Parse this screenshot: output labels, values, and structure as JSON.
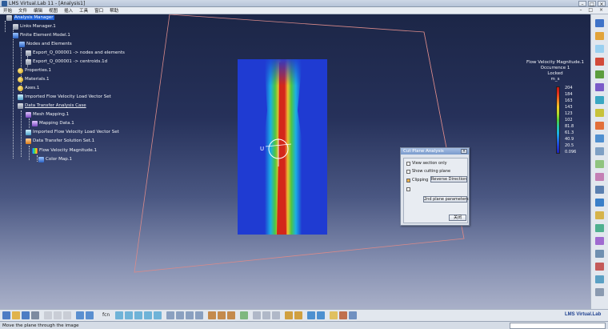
{
  "window": {
    "title": "LMS Virtual.Lab 11 - [Analysis1]",
    "minimize": "–",
    "maximize": "□",
    "close": "×"
  },
  "menu": {
    "items": [
      "开始",
      "文件",
      "编辑",
      "视图",
      "插入",
      "工具",
      "窗口",
      "帮助"
    ],
    "doc_controls": "– □ ×"
  },
  "tree": {
    "nodes": [
      {
        "label": "Analysis Manager",
        "icon": "analysis-manager-icon",
        "color": "gray",
        "selected": true
      },
      {
        "label": "Links Manager.1",
        "icon": "links-manager-icon",
        "color": "gray"
      },
      {
        "label": "Finite Element Model.1",
        "icon": "fe-model-icon",
        "color": "blue"
      },
      {
        "label": "Nodes and Elements",
        "icon": "nodes-elements-icon",
        "color": "blue"
      },
      {
        "label": "Export_Q_000001 -> nodes and elements",
        "icon": "export-icon",
        "color": "gray"
      },
      {
        "label": "Export_Q_000001 -> centroids.1d",
        "icon": "export-icon",
        "color": "gray"
      },
      {
        "label": "Properties.1",
        "icon": "properties-icon",
        "color": "yellow"
      },
      {
        "label": "Materials.1",
        "icon": "materials-icon",
        "color": "yellow"
      },
      {
        "label": "Axes.1",
        "icon": "axes-icon",
        "color": "yellow"
      },
      {
        "label": "Imported Flow Velocity Load Vector Set",
        "icon": "load-vector-icon",
        "color": "cyan"
      },
      {
        "label": "Data Transfer Analysis Case",
        "icon": "analysis-case-icon",
        "color": "gray",
        "underline": true
      },
      {
        "label": "Mesh Mapping.1",
        "icon": "mesh-mapping-icon",
        "color": "purple"
      },
      {
        "label": "Mapping Data.1",
        "icon": "mapping-data-icon",
        "color": "purple"
      },
      {
        "label": "Imported Flow Velocity Load Vector Set",
        "icon": "load-vector-icon",
        "color": "cyan"
      },
      {
        "label": "Data Transfer Solution Set.1",
        "icon": "solution-set-icon",
        "color": "orange"
      },
      {
        "label": "Flow Velocity Magnitude.1",
        "icon": "flow-velocity-icon",
        "color": "rainbow"
      },
      {
        "label": "Color Map.1",
        "icon": "color-map-icon",
        "color": "blue"
      }
    ]
  },
  "scene": {
    "axis_label": "U"
  },
  "legend": {
    "title_lines": [
      "Flow Velocity Magnitude.1",
      "Occurrence 1",
      "Locked",
      "m_s"
    ],
    "values": [
      "204",
      "184",
      "163",
      "143",
      "123",
      "102",
      "81.8",
      "61.3",
      "40.9",
      "20.5",
      "0.096"
    ]
  },
  "dialog": {
    "title": "Cut Plane Analysis",
    "close": "×",
    "view_section_only": "View section only",
    "show_cutting_plane": "Show cutting plane",
    "clipping": "Clipping",
    "reverse_direction": "Reverse Direction",
    "second_plane_parameters": "2nd plane parameters",
    "close_button": "关闭"
  },
  "bottom_toolbar": {
    "fcn_label": "fcn",
    "brand": "LMS Virtual.Lab"
  },
  "status": {
    "text": "Move the plane through the image"
  }
}
